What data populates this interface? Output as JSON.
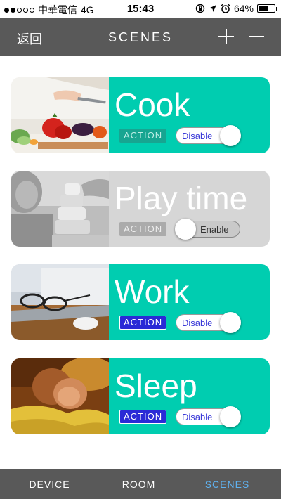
{
  "status_bar": {
    "carrier": "中華電信",
    "network": "4G",
    "time": "15:43",
    "battery_percent": "64%",
    "battery_level": 0.64,
    "signal_bars_filled": 2
  },
  "nav": {
    "back_label": "返回",
    "title": "SCENES"
  },
  "colors": {
    "active_card": "#00cdb0",
    "inactive_card": "#d6d6d6",
    "nav_bar": "#595959",
    "active_tab": "#5fb2f0"
  },
  "scenes": [
    {
      "name": "Cook",
      "action_label": "ACTION",
      "toggle_label": "Disable",
      "enabled": true
    },
    {
      "name": "Play time",
      "action_label": "ACTION",
      "toggle_label": "Enable",
      "enabled": false
    },
    {
      "name": "Work",
      "action_label": "ACTION",
      "toggle_label": "Disable",
      "enabled": true
    },
    {
      "name": "Sleep",
      "action_label": "ACTION",
      "toggle_label": "Disable",
      "enabled": true
    }
  ],
  "tabs": [
    {
      "label": "DEVICE",
      "active": false
    },
    {
      "label": "ROOM",
      "active": false
    },
    {
      "label": "SCENES",
      "active": true
    }
  ]
}
